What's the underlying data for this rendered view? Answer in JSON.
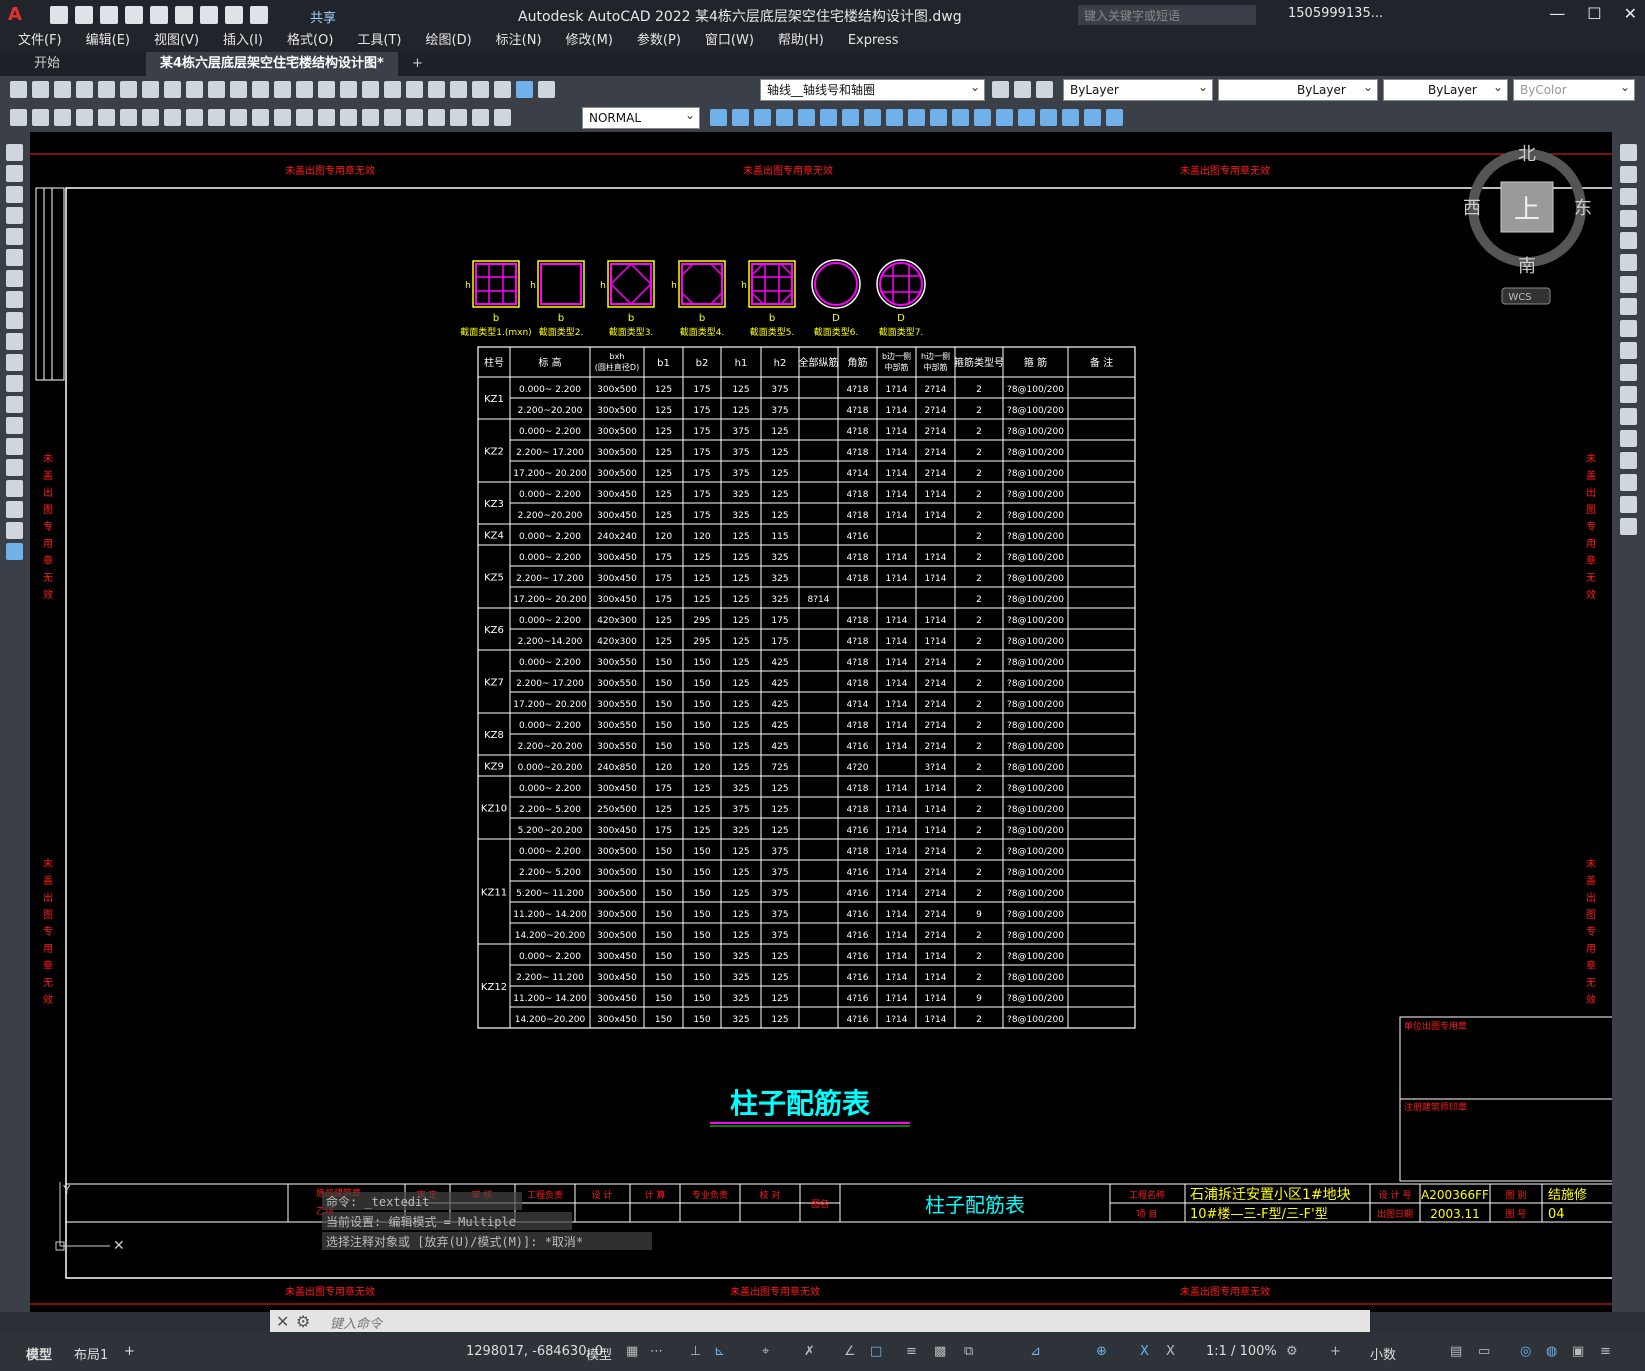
{
  "app": {
    "logo": "A",
    "share": "共享",
    "title": "Autodesk AutoCAD 2022    某4栋六层底层架空住宅楼结构设计图.dwg",
    "search_placeholder": "键入关键字或短语",
    "user": "1505999135...",
    "window_buttons": [
      "—",
      "☐",
      "✕"
    ]
  },
  "menu": [
    "文件(F)",
    "编辑(E)",
    "视图(V)",
    "插入(I)",
    "格式(O)",
    "工具(T)",
    "绘图(D)",
    "标注(N)",
    "修改(M)",
    "参数(P)",
    "窗口(W)",
    "帮助(H)",
    "Express"
  ],
  "tabs": {
    "start": "开始",
    "active": "某4栋六层底层架空住宅楼结构设计图*",
    "add": "+"
  },
  "toolbar": {
    "layer": "轴线__轴线号和轴圈",
    "color": "ByLayer",
    "linetype": "ByLayer",
    "lineweight": "ByLayer",
    "plotstyle": "ByColor",
    "textstyle": "NORMAL"
  },
  "viewcube": {
    "north": "北",
    "south": "南",
    "east": "东",
    "west": "西",
    "top": "上",
    "wcs": "WCS"
  },
  "drawing": {
    "watermark": "未盖出图专用章无效",
    "watermark_side": "未盖出图专用章无效",
    "table_title": "柱子配筋表",
    "section_labels": [
      "截面类型1.(mxn)",
      "截面类型2.",
      "截面类型3.",
      "截面类型4.",
      "截面类型5.",
      "截面类型6.",
      "截面类型7."
    ],
    "section_dims": [
      "b",
      "b",
      "b",
      "b",
      "b",
      "D",
      "D"
    ],
    "headers": [
      "柱号",
      "标 高",
      "bxh\n(圆柱直径D)",
      "b1",
      "b2",
      "h1",
      "h2",
      "全部纵筋",
      "角筋",
      "b边一侧\n中部筋",
      "h边一侧\n中部筋",
      "箍筋类型号",
      "箍 筋",
      "备 注"
    ],
    "groups": [
      {
        "name": "KZ1",
        "rows": [
          [
            "0.000~ 2.200",
            "300x500",
            "125",
            "175",
            "125",
            "375",
            "",
            "4?18",
            "1?14",
            "2?14",
            "2",
            "?8@100/200"
          ],
          [
            "2.200~20.200",
            "300x500",
            "125",
            "175",
            "125",
            "375",
            "",
            "4?18",
            "1?14",
            "2?14",
            "2",
            "?8@100/200"
          ]
        ]
      },
      {
        "name": "KZ2",
        "rows": [
          [
            "0.000~ 2.200",
            "300x500",
            "125",
            "175",
            "375",
            "125",
            "",
            "4?18",
            "1?14",
            "2?14",
            "2",
            "?8@100/200"
          ],
          [
            "2.200~ 17.200",
            "300x500",
            "125",
            "175",
            "375",
            "125",
            "",
            "4?18",
            "1?14",
            "2?14",
            "2",
            "?8@100/200"
          ],
          [
            "17.200~ 20.200",
            "300x500",
            "125",
            "175",
            "375",
            "125",
            "",
            "4?14",
            "1?14",
            "2?14",
            "2",
            "?8@100/200"
          ]
        ]
      },
      {
        "name": "KZ3",
        "rows": [
          [
            "0.000~ 2.200",
            "300x450",
            "125",
            "175",
            "325",
            "125",
            "",
            "4?18",
            "1?14",
            "1?14",
            "2",
            "?8@100/200"
          ],
          [
            "2.200~20.200",
            "300x450",
            "125",
            "175",
            "325",
            "125",
            "",
            "4?18",
            "1?14",
            "1?14",
            "2",
            "?8@100/200"
          ]
        ]
      },
      {
        "name": "KZ4",
        "rows": [
          [
            "0.000~ 2.200",
            "240x240",
            "120",
            "120",
            "125",
            "115",
            "",
            "4?16",
            "",
            "",
            "2",
            "?8@100/200"
          ]
        ]
      },
      {
        "name": "KZ5",
        "rows": [
          [
            "0.000~ 2.200",
            "300x450",
            "175",
            "125",
            "125",
            "325",
            "",
            "4?18",
            "1?14",
            "1?14",
            "2",
            "?8@100/200"
          ],
          [
            "2.200~ 17.200",
            "300x450",
            "175",
            "125",
            "125",
            "325",
            "",
            "4?18",
            "1?14",
            "1?14",
            "2",
            "?8@100/200"
          ],
          [
            "17.200~ 20.200",
            "300x450",
            "175",
            "125",
            "125",
            "325",
            "8?14",
            "",
            "",
            "",
            "2",
            "?8@100/200"
          ]
        ]
      },
      {
        "name": "KZ6",
        "rows": [
          [
            "0.000~ 2.200",
            "420x300",
            "125",
            "295",
            "125",
            "175",
            "",
            "4?18",
            "1?14",
            "1?14",
            "2",
            "?8@100/200"
          ],
          [
            "2.200~14.200",
            "420x300",
            "125",
            "295",
            "125",
            "175",
            "",
            "4?18",
            "1?14",
            "1?14",
            "2",
            "?8@100/200"
          ]
        ]
      },
      {
        "name": "KZ7",
        "rows": [
          [
            "0.000~ 2.200",
            "300x550",
            "150",
            "150",
            "125",
            "425",
            "",
            "4?18",
            "1?14",
            "2?14",
            "2",
            "?8@100/200"
          ],
          [
            "2.200~ 17.200",
            "300x550",
            "150",
            "150",
            "125",
            "425",
            "",
            "4?18",
            "1?14",
            "2?14",
            "2",
            "?8@100/200"
          ],
          [
            "17.200~ 20.200",
            "300x550",
            "150",
            "150",
            "125",
            "425",
            "",
            "4?14",
            "1?14",
            "2?14",
            "2",
            "?8@100/200"
          ]
        ]
      },
      {
        "name": "KZ8",
        "rows": [
          [
            "0.000~ 2.200",
            "300x550",
            "150",
            "150",
            "125",
            "425",
            "",
            "4?18",
            "1?14",
            "2?14",
            "2",
            "?8@100/200"
          ],
          [
            "2.200~20.200",
            "300x550",
            "150",
            "150",
            "125",
            "425",
            "",
            "4?16",
            "1?14",
            "2?14",
            "2",
            "?8@100/200"
          ]
        ]
      },
      {
        "name": "KZ9",
        "rows": [
          [
            "0.000~20.200",
            "240x850",
            "120",
            "120",
            "125",
            "725",
            "",
            "4?20",
            "",
            "3?14",
            "2",
            "?8@100/200"
          ]
        ]
      },
      {
        "name": "KZ10",
        "rows": [
          [
            "0.000~ 2.200",
            "300x450",
            "175",
            "125",
            "325",
            "125",
            "",
            "4?18",
            "1?14",
            "1?14",
            "2",
            "?8@100/200"
          ],
          [
            "2.200~ 5.200",
            "250x500",
            "125",
            "125",
            "375",
            "125",
            "",
            "4?18",
            "1?14",
            "1?14",
            "2",
            "?8@100/200"
          ],
          [
            "5.200~20.200",
            "300x450",
            "175",
            "125",
            "325",
            "125",
            "",
            "4?16",
            "1?14",
            "1?14",
            "2",
            "?8@100/200"
          ]
        ]
      },
      {
        "name": "KZ11",
        "rows": [
          [
            "0.000~ 2.200",
            "300x500",
            "150",
            "150",
            "125",
            "375",
            "",
            "4?18",
            "1?14",
            "2?14",
            "2",
            "?8@100/200"
          ],
          [
            "2.200~ 5.200",
            "300x500",
            "150",
            "150",
            "125",
            "375",
            "",
            "4?16",
            "1?14",
            "2?14",
            "2",
            "?8@100/200"
          ],
          [
            "5.200~ 11.200",
            "300x500",
            "150",
            "150",
            "125",
            "375",
            "",
            "4?16",
            "1?14",
            "2?14",
            "2",
            "?8@100/200"
          ],
          [
            "11.200~ 14.200",
            "300x500",
            "150",
            "150",
            "125",
            "375",
            "",
            "4?16",
            "1?14",
            "2?14",
            "9",
            "?8@100/200"
          ],
          [
            "14.200~20.200",
            "300x500",
            "150",
            "150",
            "125",
            "375",
            "",
            "4?16",
            "1?14",
            "2?14",
            "2",
            "?8@100/200"
          ]
        ]
      },
      {
        "name": "KZ12",
        "rows": [
          [
            "0.000~ 2.200",
            "300x450",
            "150",
            "150",
            "325",
            "125",
            "",
            "4?16",
            "1?14",
            "1?14",
            "2",
            "?8@100/200"
          ],
          [
            "2.200~ 11.200",
            "300x450",
            "150",
            "150",
            "325",
            "125",
            "",
            "4?16",
            "1?14",
            "1?14",
            "2",
            "?8@100/200"
          ],
          [
            "11.200~ 14.200",
            "300x450",
            "150",
            "150",
            "325",
            "125",
            "",
            "4?16",
            "1?14",
            "1?14",
            "9",
            "?8@100/200"
          ],
          [
            "14.200~20.200",
            "300x450",
            "150",
            "150",
            "325",
            "125",
            "",
            "4?16",
            "1?14",
            "1?14",
            "2",
            "?8@100/200"
          ]
        ]
      }
    ],
    "titleblock": {
      "drawing_name": "柱子配筋表",
      "project_name_label": "工程名称",
      "project_name": "石浦拆迁安置小区1#地块",
      "item_label": "项 目",
      "item": "10#楼—三-F型/三-F'型",
      "design_no_label": "设 计 号",
      "design_no": "A200366FF",
      "date_label": "出图日期",
      "date": "2003.11",
      "drawing_type_label": "图 别",
      "drawing_type": "结施修",
      "drawing_no_label": "图 号",
      "drawing_no": "04",
      "roles": [
        "审 定",
        "审 核",
        "工程负责",
        "设 计",
        "计 算",
        "专业负责",
        "校 对"
      ],
      "drawing_label": "图名",
      "left_notes": [
        "施加建筑章",
        "乙级 "
      ],
      "stamp1": "单位出图专用章",
      "stamp2": "注册建筑师印章"
    }
  },
  "command": {
    "history": [
      "命令: _textedit",
      "当前设置: 编辑模式 = Multiple",
      "选择注释对象或 [放弃(U)/模式(M)]: *取消*"
    ],
    "placeholder": "键入命令"
  },
  "status": {
    "tab_model": "模型",
    "tab_layout": "布局1",
    "add": "+",
    "coords": "1298017, -684630, 0",
    "model": "模型",
    "scale": "1:1 / 100%",
    "units": "小数"
  },
  "colors": {
    "accent_red": "#ff1a1a",
    "table_white": "#ffffff",
    "magenta": "#ff00ff",
    "yellow": "#ffff00",
    "cyan": "#00ffff"
  }
}
